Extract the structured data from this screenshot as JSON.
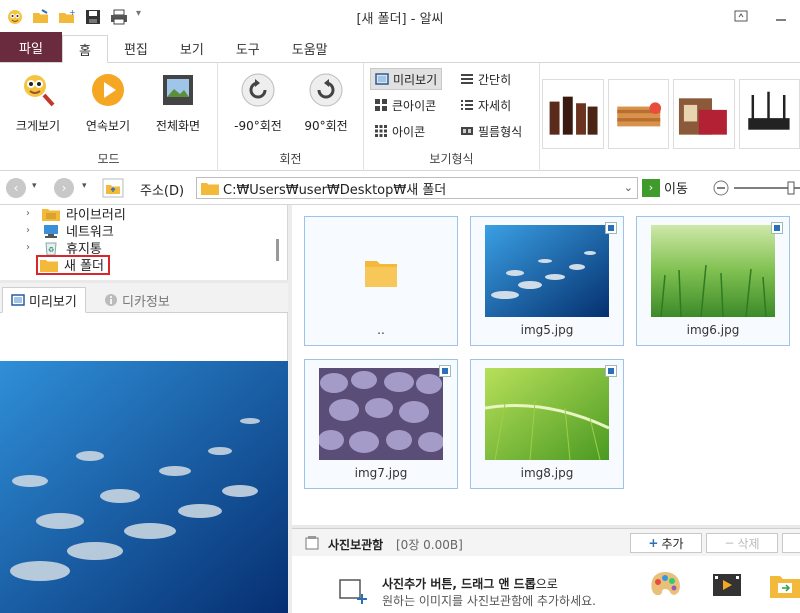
{
  "window": {
    "title": "[새 폴더] - 알씨"
  },
  "ribbon_tabs": [
    "파일",
    "홈",
    "편집",
    "보기",
    "도구",
    "도움말"
  ],
  "ribbon": {
    "mode": {
      "label": "모드",
      "buttons": [
        "크게보기",
        "연속보기",
        "전체화면"
      ]
    },
    "rotate": {
      "label": "회전",
      "buttons": [
        "-90°회전",
        "90°회전"
      ]
    },
    "view_format": {
      "label": "보기형식",
      "options": [
        "미리보기",
        "간단히",
        "큰아이콘",
        "자세히",
        "아이콘",
        "필름형식"
      ],
      "selected": "미리보기"
    }
  },
  "address": {
    "label": "주소(D)",
    "path": "C:₩Users₩user₩Desktop₩새 폴더",
    "go_label": "이동"
  },
  "tree": {
    "items": [
      "라이브러리",
      "네트워크",
      "휴지통",
      "새 폴더"
    ],
    "selected": "새 폴더"
  },
  "preview_tabs": [
    "미리보기",
    "디카정보"
  ],
  "files": [
    {
      "name": ".."
    },
    {
      "name": "img5.jpg"
    },
    {
      "name": "img6.jpg"
    },
    {
      "name": "img7.jpg"
    },
    {
      "name": "img8.jpg"
    }
  ],
  "storage": {
    "title": "사진보관함",
    "count": "[0장 0.00B]",
    "add_label": "추가",
    "delete_label": "삭제",
    "hint_bold": "사진추가 버튼, 드래그 앤 드롭",
    "hint_rest": "으로",
    "hint_line2": "원하는 이미지를 사진보관함에 추가하세요."
  },
  "colors": {
    "file_tab": "#6b2b3e",
    "tile_border": "#9cc3ea",
    "selection_outline": "#d8262b",
    "go_green": "#3f9b2b"
  }
}
